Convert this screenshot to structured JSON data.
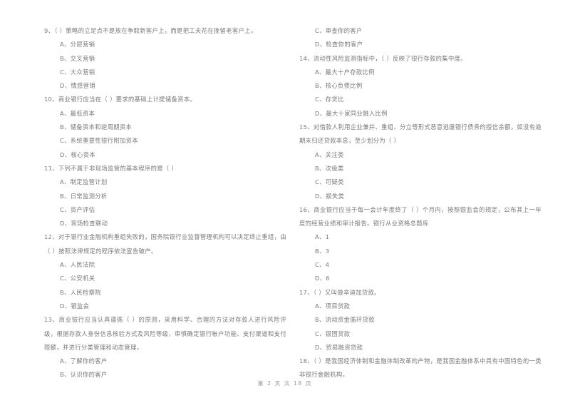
{
  "document": {
    "type": "scanned-exam-paper",
    "subject": "银行从业资格总题库",
    "footer": "第 2 页  共 18 页",
    "text_color": "#707376",
    "background_color": "#ffffff"
  },
  "left_column": [
    {
      "number": "9",
      "stem": "9、（      ）策略的立足点不是放在争取新客户上，而是把工夫花在挽留老客户上。",
      "options": [
        "A、分层营销",
        "B、交叉营销",
        "C、大众营销",
        "D、情感营销"
      ]
    },
    {
      "number": "10",
      "stem": "10、商业银行应当在（      ）要求的基础上计提储备资本。",
      "options": [
        "A、最低资本",
        "B、储备资本和逆周期资本",
        "C、系统重要性银行附加资本",
        "D、核心资本"
      ]
    },
    {
      "number": "11",
      "stem": "11、下列不属于非现场监管的基本程序的是（      ）",
      "options": [
        "A、制定监管计划",
        "B、日常监测分析",
        "C、资产评估",
        "D、现场检查联动"
      ]
    },
    {
      "number": "12",
      "stem": "12、对于银行业金融机构重组失败的，国务院银行业监督管理机构可以决定终止重组，由（      ）按照法律规定的程序依法宣告破产。",
      "options": [
        "A、人民法院",
        "C、公安机关",
        "B、人民检察院",
        "D、银监会"
      ]
    },
    {
      "number": "13",
      "stem": "13、商业银行应当认真遵循（      ）的原则，采用科学、合理的方法对存款人进行风险评级，根据存款人身份信息核验方式及风险等级，审慎确定银行帐户功能、支付渠道和支付限额，并进行分类管理和动态管理。",
      "options": [
        "A、了解你的客户",
        "B、认识你的客户"
      ]
    }
  ],
  "right_column": [
    {
      "number": "13-cont",
      "stem": "",
      "options": [
        "C、审查你的客户",
        "D、检查你的客户"
      ]
    },
    {
      "number": "14",
      "stem": "14、流动性风险监测指标中，（      ）反映了银行存款的集中度。",
      "options": [
        "A、最大十户存款比例",
        "B、核心负债比例",
        "C、存贷比",
        "D、最大十家同业融入比例"
      ]
    },
    {
      "number": "15",
      "stem": "15、对借款人利用企业兼并、重组、分立等形式恶意逃废银行债务的授信余额，如没有逾期未归还贷款本息，至少划分为（      ）",
      "options": [
        "A、关注类",
        "B、次级类",
        "C、可疑类",
        "D、损失类"
      ]
    },
    {
      "number": "16",
      "stem": "16、商业银行应当于每一会计年度终了（      ）个月内，按照银监会的规定，公布其上一年度的经营业绩和审计报告。银行从业资格总题库",
      "options": [
        "A、1",
        "B、3",
        "C、4",
        "D、6"
      ]
    },
    {
      "number": "17",
      "stem": "17、（      ）又叫做辛迪加贷款。",
      "options": [
        "A、项目贷款",
        "B、流动资金循环贷款",
        "C、银团贷款",
        "D、贸易融资贷款"
      ]
    },
    {
      "number": "18",
      "stem": "18、（      ）是我国经济体制和金融体制改革的产物，是我国金融体系中具有中国特色的一类非银行金融机构。",
      "options": []
    }
  ]
}
